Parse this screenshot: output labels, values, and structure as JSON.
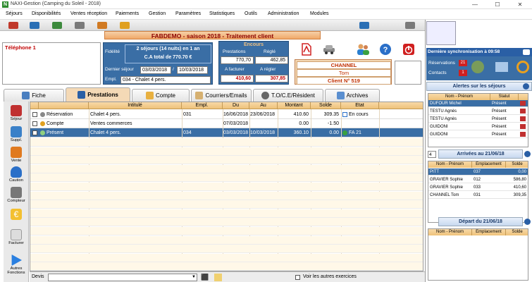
{
  "window": {
    "title": "NAXI-Gestion (Camping du Soleil - 2018)"
  },
  "menu": [
    "Séjours",
    "Disponibilités",
    "Ventes réception",
    "Paiements",
    "Gestion",
    "Paramètres",
    "Statistiques",
    "Outils",
    "Administration",
    "Modules"
  ],
  "banner": "FABDEMO - saison 2018 - Traitement client",
  "phone_label": "Téléphone 1",
  "fidelity": {
    "label": "Fidélité",
    "text1": "2 séjours (14 nuits) en 1 an",
    "text2": "C.A total de 770.70 €"
  },
  "last_stay": {
    "label": "Dernier séjour",
    "from": "03/03/2018",
    "sep": "/",
    "to": "10/03/2018"
  },
  "empl": {
    "label": "Empl.",
    "value": "034 - Chalet 4 pers."
  },
  "encours": {
    "title": "Encours",
    "prestations_label": "Prestations",
    "regle_label": "Réglé",
    "prestations": "770,70",
    "regle": "462,85",
    "afacturer_label": "A facturer",
    "aregler_label": "A régler",
    "afacturer": "410,60",
    "aregler": "307,85"
  },
  "client": {
    "type": "CHANNEL",
    "name": "Tom",
    "number": "Client N° 519"
  },
  "tabs": [
    "Fiche",
    "Prestations",
    "Compte",
    "Courriers/Emails",
    "T.O/C.E/Résident",
    "Archives"
  ],
  "left_buttons": [
    "Séjour",
    "Suppl.",
    "Vente",
    "Caution",
    "Compteur",
    "",
    "Facturer",
    "Autres Fonctions"
  ],
  "grid": {
    "headers": [
      "Intitulé",
      "Empl.",
      "Du",
      "Au",
      "Montant",
      "Solde",
      "Etat"
    ],
    "rows": [
      {
        "type": "Réservation",
        "label": "Chalet 4 pers.",
        "empl": "031",
        "du": "16/06/2018",
        "au": "23/06/2018",
        "montant": "410.60",
        "solde": "309.35",
        "etat": "En cours"
      },
      {
        "type": "Compte",
        "label": "Ventes commerces",
        "empl": "",
        "du": "07/03/2018",
        "au": "",
        "montant": "0.00",
        "solde": "-1.50",
        "etat": ""
      },
      {
        "type": "Présent",
        "label": "Chalet 4 pers.",
        "empl": "034",
        "du": "03/03/2018",
        "au": "10/03/2018",
        "montant": "360.10",
        "solde": "0.00",
        "etat": "FA 21"
      }
    ]
  },
  "bottom": {
    "devis_label": "Devis",
    "voir_label": "Voir les autres exercices"
  },
  "right": {
    "sync": "Dernière synchronisation à 09:58",
    "reservations_label": "Réservations",
    "reservations_count": "21",
    "contacts_label": "Contacts",
    "contacts_count": "1",
    "alerts_title": "Alertes sur les séjours",
    "alerts_headers": [
      "Nom - Prénom",
      "Statut"
    ],
    "alerts_rows": [
      {
        "name": "DUFOUR Michel",
        "status": "Présent"
      },
      {
        "name": "TESTU Agnès",
        "status": "Présent"
      },
      {
        "name": "TESTU Agnès",
        "status": "Présent"
      },
      {
        "name": "GUIDONI",
        "status": "Présent"
      },
      {
        "name": "GUIDONI",
        "status": "Présent"
      }
    ],
    "arrivals_count": "4",
    "arrivals_title": "Arrivées au 21/06/18",
    "arrivals_headers": [
      "Nom - Prénom",
      "Emplacement",
      "Solde"
    ],
    "arrivals_rows": [
      {
        "name": "PITT",
        "empl": "037",
        "solde": "0,00"
      },
      {
        "name": "GRAVIER Sophie",
        "empl": "012",
        "solde": "586,80"
      },
      {
        "name": "GRAVIER Sophie",
        "empl": "033",
        "solde": "410,60"
      },
      {
        "name": "CHANNEL Tom",
        "empl": "031",
        "solde": "309,35"
      }
    ],
    "departures_title": "Départ du 21/06/18",
    "departures_headers": [
      "Nom - Prénom",
      "Emplacement",
      "Solde"
    ]
  }
}
